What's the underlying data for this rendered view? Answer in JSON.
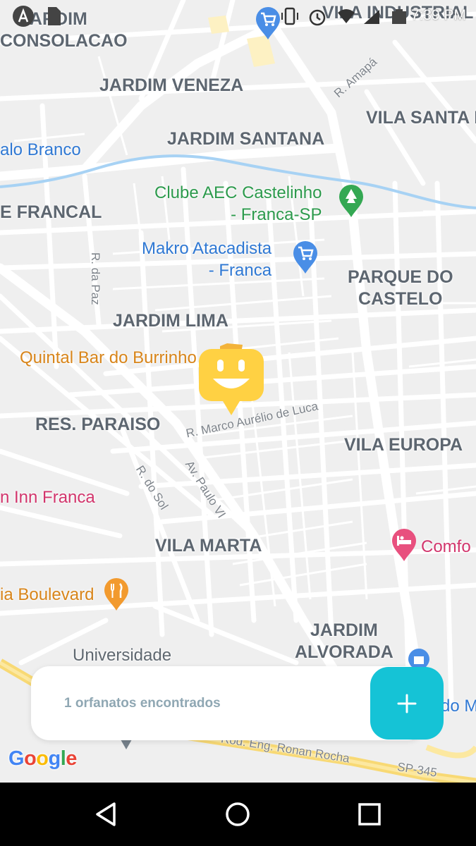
{
  "status_bar": {
    "time": "7:39 PM"
  },
  "map": {
    "neighborhoods": {
      "jardim_consolacao": "JARDIM\nCONSOLACAO",
      "vila_industrial": "VILA INDUSTRIAL",
      "jardim_veneza": "JARDIM VENEZA",
      "vila_santa": "VILA SANTA R",
      "jardim_santana": "JARDIM SANTANA",
      "francal": "E FRANCAL",
      "parque_castelo": "PARQUE DO\nCASTELO",
      "jardim_lima": "JARDIM LIMA",
      "res_paraiso": "RES. PARAISO",
      "vila_europa": "VILA EUROPA",
      "vila_marta": "VILA MARTA",
      "jardim_alvorada": "JARDIM\nALVORADA"
    },
    "pois": {
      "palo_branco": "alo Branco",
      "clube_aec": "Clube AEC Castelinho\n- Franca-SP",
      "makro": "Makro Atacadista\n- Franca",
      "quintal_bar": "Quintal Bar do Burrinho",
      "inn_franca": "n Inn Franca",
      "comfort": "Comfo",
      "boulevard": "ia Boulevard",
      "universidade": "Universidade",
      "do_m": "do M"
    },
    "streets": {
      "r_amapa": "R. Amapá",
      "r_da_paz": "R. da Paz",
      "r_marco": "R. Marco Aurélio de Luca",
      "r_do_sol": "R. do Sol",
      "av_paulo": "Av. Paulo VI",
      "rod_eng": "Rod. Eng. Ronan Rocha",
      "sp345": "SP-345"
    },
    "google_logo": "Google",
    "marker_icon": "smiley-face-icon",
    "colors": {
      "accent": "#15c3d6",
      "marker": "#ffd143",
      "marker_shadow": "#f3b33a"
    }
  },
  "footer": {
    "results_text": "1 orfanatos encontrados",
    "add_button_icon": "plus-icon"
  },
  "nav_bar": {
    "back_icon": "back-triangle-icon",
    "home_icon": "home-circle-icon",
    "recents_icon": "recents-square-icon"
  }
}
